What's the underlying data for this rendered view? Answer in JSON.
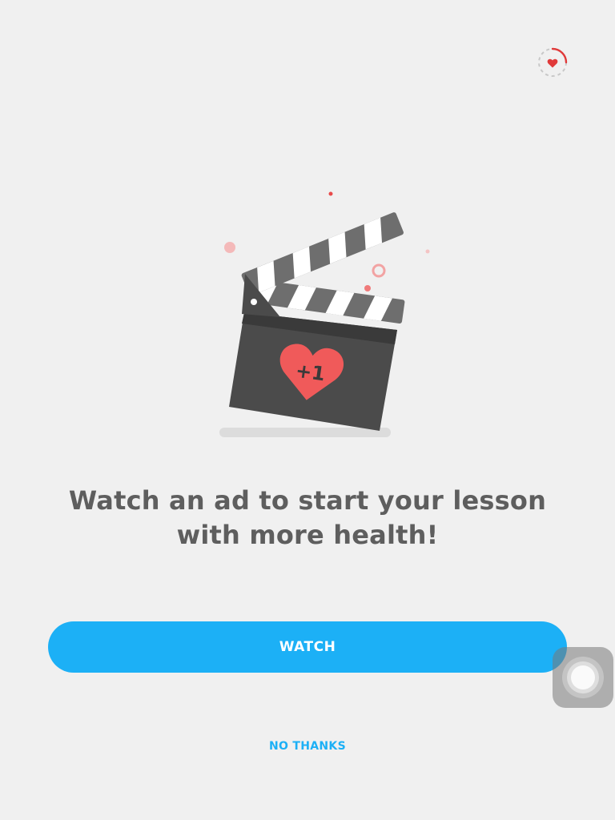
{
  "header": {
    "health_icon": "heart-timer-icon",
    "heart_color": "#e03a3a"
  },
  "illustration": {
    "icon": "clapperboard-icon",
    "badge_text": "+1",
    "badge_icon": "heart-icon",
    "badge_color": "#f05a5a"
  },
  "main": {
    "headline": "Watch an ad to start your lesson with more health!"
  },
  "actions": {
    "watch_label": "WATCH",
    "no_thanks_label": "NO THANKS"
  },
  "colors": {
    "background": "#f0f0f0",
    "primary": "#1cb0f6",
    "headline": "#5e5e5e",
    "clapper": "#4b4b4b",
    "heart": "#f05a5a"
  },
  "overlay": {
    "assistive_touch_icon": "assistive-touch-icon"
  }
}
